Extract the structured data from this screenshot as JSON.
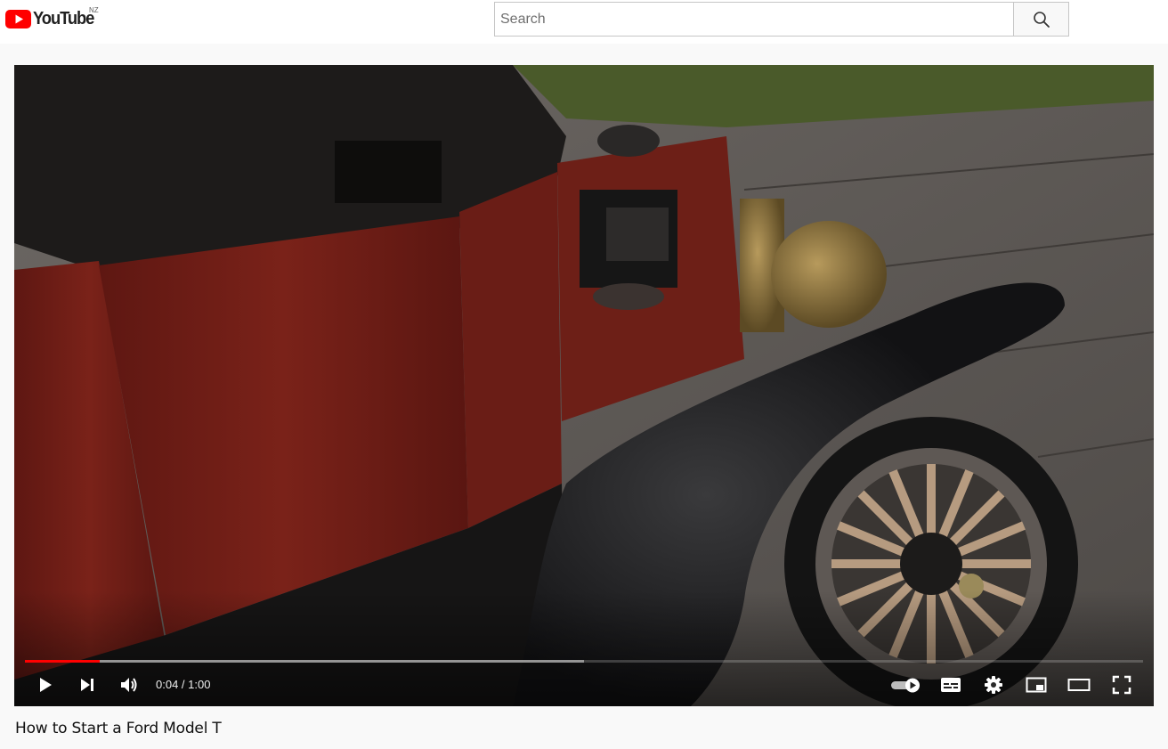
{
  "masthead": {
    "logo_text": "YouTube",
    "country_code": "NZ",
    "search_placeholder": "Search",
    "search_value": ""
  },
  "player": {
    "current_time": "0:04",
    "separator": " / ",
    "duration": "1:00",
    "progress_played_fraction": 0.067,
    "progress_loaded_fraction": 0.5,
    "autoplay": "on",
    "controls": [
      "play-icon",
      "next-icon",
      "volume-icon",
      "autoplay-toggle-icon",
      "subtitles-icon",
      "settings-gear-icon",
      "miniplayer-icon",
      "theater-mode-icon",
      "fullscreen-icon"
    ]
  },
  "video": {
    "title": "How to Start a Ford Model T"
  },
  "colors": {
    "brand_red": "#ff0000",
    "text_dark": "#0f0f0f",
    "page_bg": "#f9f9f9"
  }
}
